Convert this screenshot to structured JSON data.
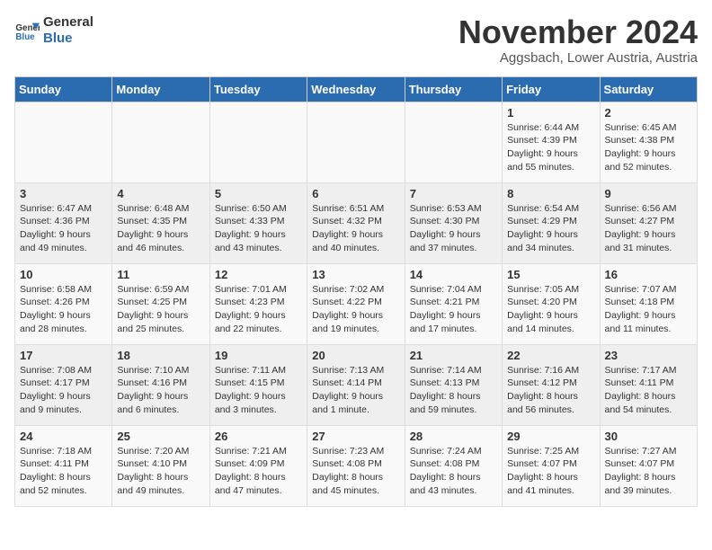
{
  "logo": {
    "line1": "General",
    "line2": "Blue"
  },
  "title": "November 2024",
  "subtitle": "Aggsbach, Lower Austria, Austria",
  "days_of_week": [
    "Sunday",
    "Monday",
    "Tuesday",
    "Wednesday",
    "Thursday",
    "Friday",
    "Saturday"
  ],
  "weeks": [
    [
      {
        "day": "",
        "info": ""
      },
      {
        "day": "",
        "info": ""
      },
      {
        "day": "",
        "info": ""
      },
      {
        "day": "",
        "info": ""
      },
      {
        "day": "",
        "info": ""
      },
      {
        "day": "1",
        "info": "Sunrise: 6:44 AM\nSunset: 4:39 PM\nDaylight: 9 hours and 55 minutes."
      },
      {
        "day": "2",
        "info": "Sunrise: 6:45 AM\nSunset: 4:38 PM\nDaylight: 9 hours and 52 minutes."
      }
    ],
    [
      {
        "day": "3",
        "info": "Sunrise: 6:47 AM\nSunset: 4:36 PM\nDaylight: 9 hours and 49 minutes."
      },
      {
        "day": "4",
        "info": "Sunrise: 6:48 AM\nSunset: 4:35 PM\nDaylight: 9 hours and 46 minutes."
      },
      {
        "day": "5",
        "info": "Sunrise: 6:50 AM\nSunset: 4:33 PM\nDaylight: 9 hours and 43 minutes."
      },
      {
        "day": "6",
        "info": "Sunrise: 6:51 AM\nSunset: 4:32 PM\nDaylight: 9 hours and 40 minutes."
      },
      {
        "day": "7",
        "info": "Sunrise: 6:53 AM\nSunset: 4:30 PM\nDaylight: 9 hours and 37 minutes."
      },
      {
        "day": "8",
        "info": "Sunrise: 6:54 AM\nSunset: 4:29 PM\nDaylight: 9 hours and 34 minutes."
      },
      {
        "day": "9",
        "info": "Sunrise: 6:56 AM\nSunset: 4:27 PM\nDaylight: 9 hours and 31 minutes."
      }
    ],
    [
      {
        "day": "10",
        "info": "Sunrise: 6:58 AM\nSunset: 4:26 PM\nDaylight: 9 hours and 28 minutes."
      },
      {
        "day": "11",
        "info": "Sunrise: 6:59 AM\nSunset: 4:25 PM\nDaylight: 9 hours and 25 minutes."
      },
      {
        "day": "12",
        "info": "Sunrise: 7:01 AM\nSunset: 4:23 PM\nDaylight: 9 hours and 22 minutes."
      },
      {
        "day": "13",
        "info": "Sunrise: 7:02 AM\nSunset: 4:22 PM\nDaylight: 9 hours and 19 minutes."
      },
      {
        "day": "14",
        "info": "Sunrise: 7:04 AM\nSunset: 4:21 PM\nDaylight: 9 hours and 17 minutes."
      },
      {
        "day": "15",
        "info": "Sunrise: 7:05 AM\nSunset: 4:20 PM\nDaylight: 9 hours and 14 minutes."
      },
      {
        "day": "16",
        "info": "Sunrise: 7:07 AM\nSunset: 4:18 PM\nDaylight: 9 hours and 11 minutes."
      }
    ],
    [
      {
        "day": "17",
        "info": "Sunrise: 7:08 AM\nSunset: 4:17 PM\nDaylight: 9 hours and 9 minutes."
      },
      {
        "day": "18",
        "info": "Sunrise: 7:10 AM\nSunset: 4:16 PM\nDaylight: 9 hours and 6 minutes."
      },
      {
        "day": "19",
        "info": "Sunrise: 7:11 AM\nSunset: 4:15 PM\nDaylight: 9 hours and 3 minutes."
      },
      {
        "day": "20",
        "info": "Sunrise: 7:13 AM\nSunset: 4:14 PM\nDaylight: 9 hours and 1 minute."
      },
      {
        "day": "21",
        "info": "Sunrise: 7:14 AM\nSunset: 4:13 PM\nDaylight: 8 hours and 59 minutes."
      },
      {
        "day": "22",
        "info": "Sunrise: 7:16 AM\nSunset: 4:12 PM\nDaylight: 8 hours and 56 minutes."
      },
      {
        "day": "23",
        "info": "Sunrise: 7:17 AM\nSunset: 4:11 PM\nDaylight: 8 hours and 54 minutes."
      }
    ],
    [
      {
        "day": "24",
        "info": "Sunrise: 7:18 AM\nSunset: 4:11 PM\nDaylight: 8 hours and 52 minutes."
      },
      {
        "day": "25",
        "info": "Sunrise: 7:20 AM\nSunset: 4:10 PM\nDaylight: 8 hours and 49 minutes."
      },
      {
        "day": "26",
        "info": "Sunrise: 7:21 AM\nSunset: 4:09 PM\nDaylight: 8 hours and 47 minutes."
      },
      {
        "day": "27",
        "info": "Sunrise: 7:23 AM\nSunset: 4:08 PM\nDaylight: 8 hours and 45 minutes."
      },
      {
        "day": "28",
        "info": "Sunrise: 7:24 AM\nSunset: 4:08 PM\nDaylight: 8 hours and 43 minutes."
      },
      {
        "day": "29",
        "info": "Sunrise: 7:25 AM\nSunset: 4:07 PM\nDaylight: 8 hours and 41 minutes."
      },
      {
        "day": "30",
        "info": "Sunrise: 7:27 AM\nSunset: 4:07 PM\nDaylight: 8 hours and 39 minutes."
      }
    ]
  ]
}
